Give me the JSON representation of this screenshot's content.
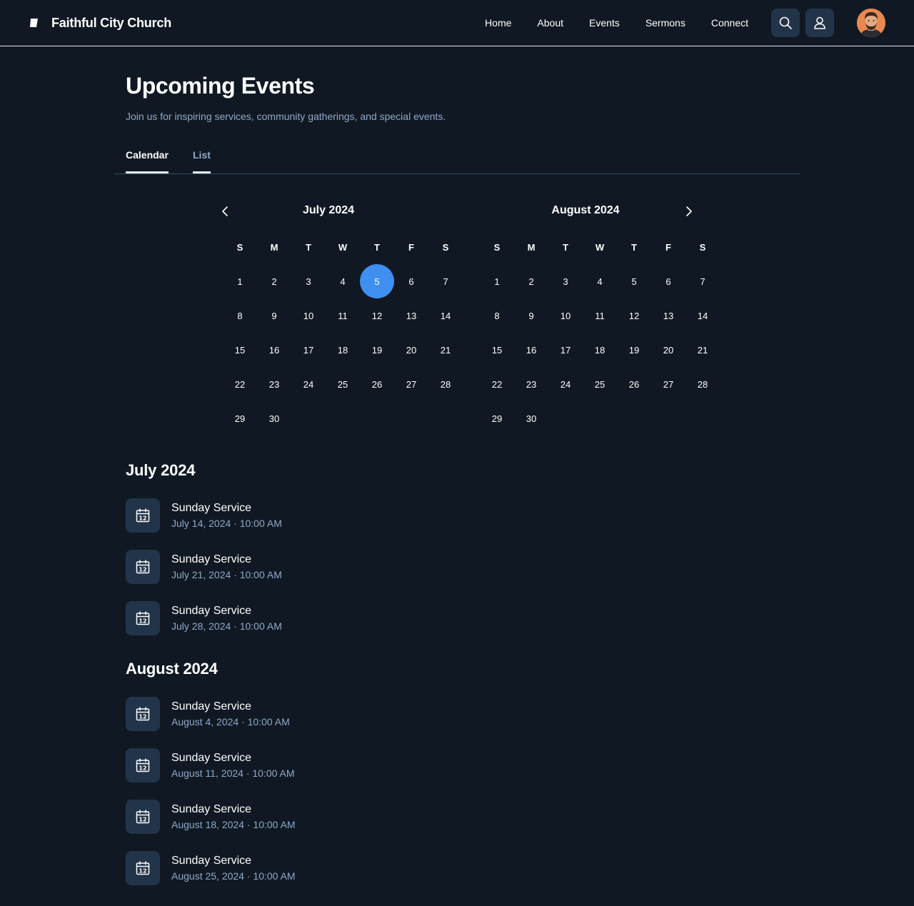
{
  "header": {
    "brand": "Faithful City Church",
    "nav": [
      "Home",
      "About",
      "Events",
      "Sermons",
      "Connect"
    ],
    "search_icon": "search-icon",
    "user_icon": "user-icon"
  },
  "page": {
    "title": "Upcoming Events",
    "subtitle": "Join us for inspiring services, community gatherings, and special events."
  },
  "tabs": {
    "calendar": "Calendar",
    "list": "List",
    "active": "Calendar"
  },
  "calendar": {
    "weekdays": [
      "S",
      "M",
      "T",
      "W",
      "T",
      "F",
      "S"
    ],
    "months": [
      {
        "title": "July 2024",
        "days": 30,
        "selected": 5
      },
      {
        "title": "August 2024",
        "days": 30
      }
    ],
    "accent": "#3f8ff0"
  },
  "event_groups": [
    {
      "title": "July 2024",
      "events": [
        {
          "name": "Sunday Service",
          "date": "July 14, 2024 · 10:00 AM"
        },
        {
          "name": "Sunday Service",
          "date": "July 21, 2024 · 10:00 AM"
        },
        {
          "name": "Sunday Service",
          "date": "July 28, 2024 · 10:00 AM"
        }
      ]
    },
    {
      "title": "August 2024",
      "events": [
        {
          "name": "Sunday Service",
          "date": "August 4, 2024 · 10:00 AM"
        },
        {
          "name": "Sunday Service",
          "date": "August 11, 2024 · 10:00 AM"
        },
        {
          "name": "Sunday Service",
          "date": "August 18, 2024 · 10:00 AM"
        },
        {
          "name": "Sunday Service",
          "date": "August 25, 2024 · 10:00 AM"
        }
      ]
    }
  ],
  "event_icon": "calendar-icon"
}
